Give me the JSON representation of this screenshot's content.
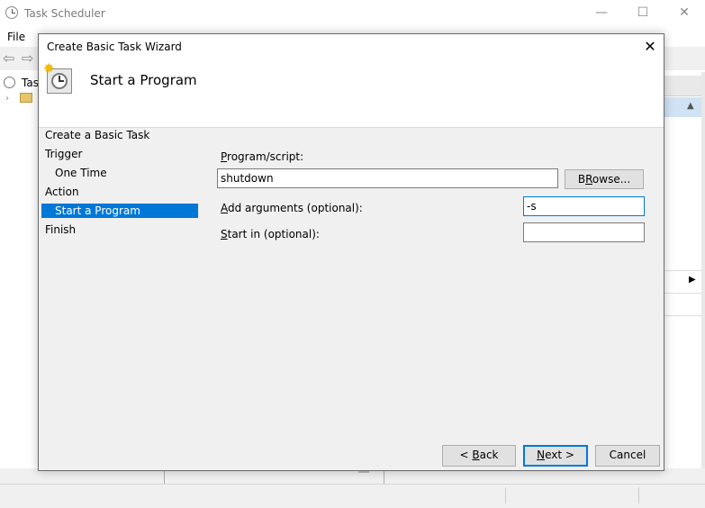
{
  "background_window": {
    "title": "Task Scheduler",
    "menu": {
      "file": "File"
    },
    "tree_root_label": "Task",
    "window_controls": {
      "minimize": "—",
      "maximize": "☐",
      "close": "✕"
    }
  },
  "dialog": {
    "title": "Create Basic Task Wizard",
    "close_glyph": "✕",
    "header_title": "Start a Program",
    "steps": [
      {
        "label": "Create a Basic Task"
      },
      {
        "label": "Trigger"
      },
      {
        "label": "One Time"
      },
      {
        "label": "Action"
      },
      {
        "label": "Start a Program",
        "selected": true
      },
      {
        "label": "Finish"
      }
    ],
    "form": {
      "program_label_access": "P",
      "program_label_rest": "rogram/script:",
      "program_value": "shutdown",
      "browse_access": "R",
      "browse_pre": "B",
      "browse_rest": "owse...",
      "args_label_access": "A",
      "args_label_rest": "dd arguments (optional):",
      "args_value": "-s",
      "startin_label_access": "S",
      "startin_label_rest": "tart in (optional):",
      "startin_value": ""
    },
    "buttons": {
      "back_prefix": "< ",
      "back_access": "B",
      "back_rest": "ack",
      "next_access": "N",
      "next_rest": "ext >",
      "cancel": "Cancel"
    },
    "selection_color": "#0078d7"
  }
}
